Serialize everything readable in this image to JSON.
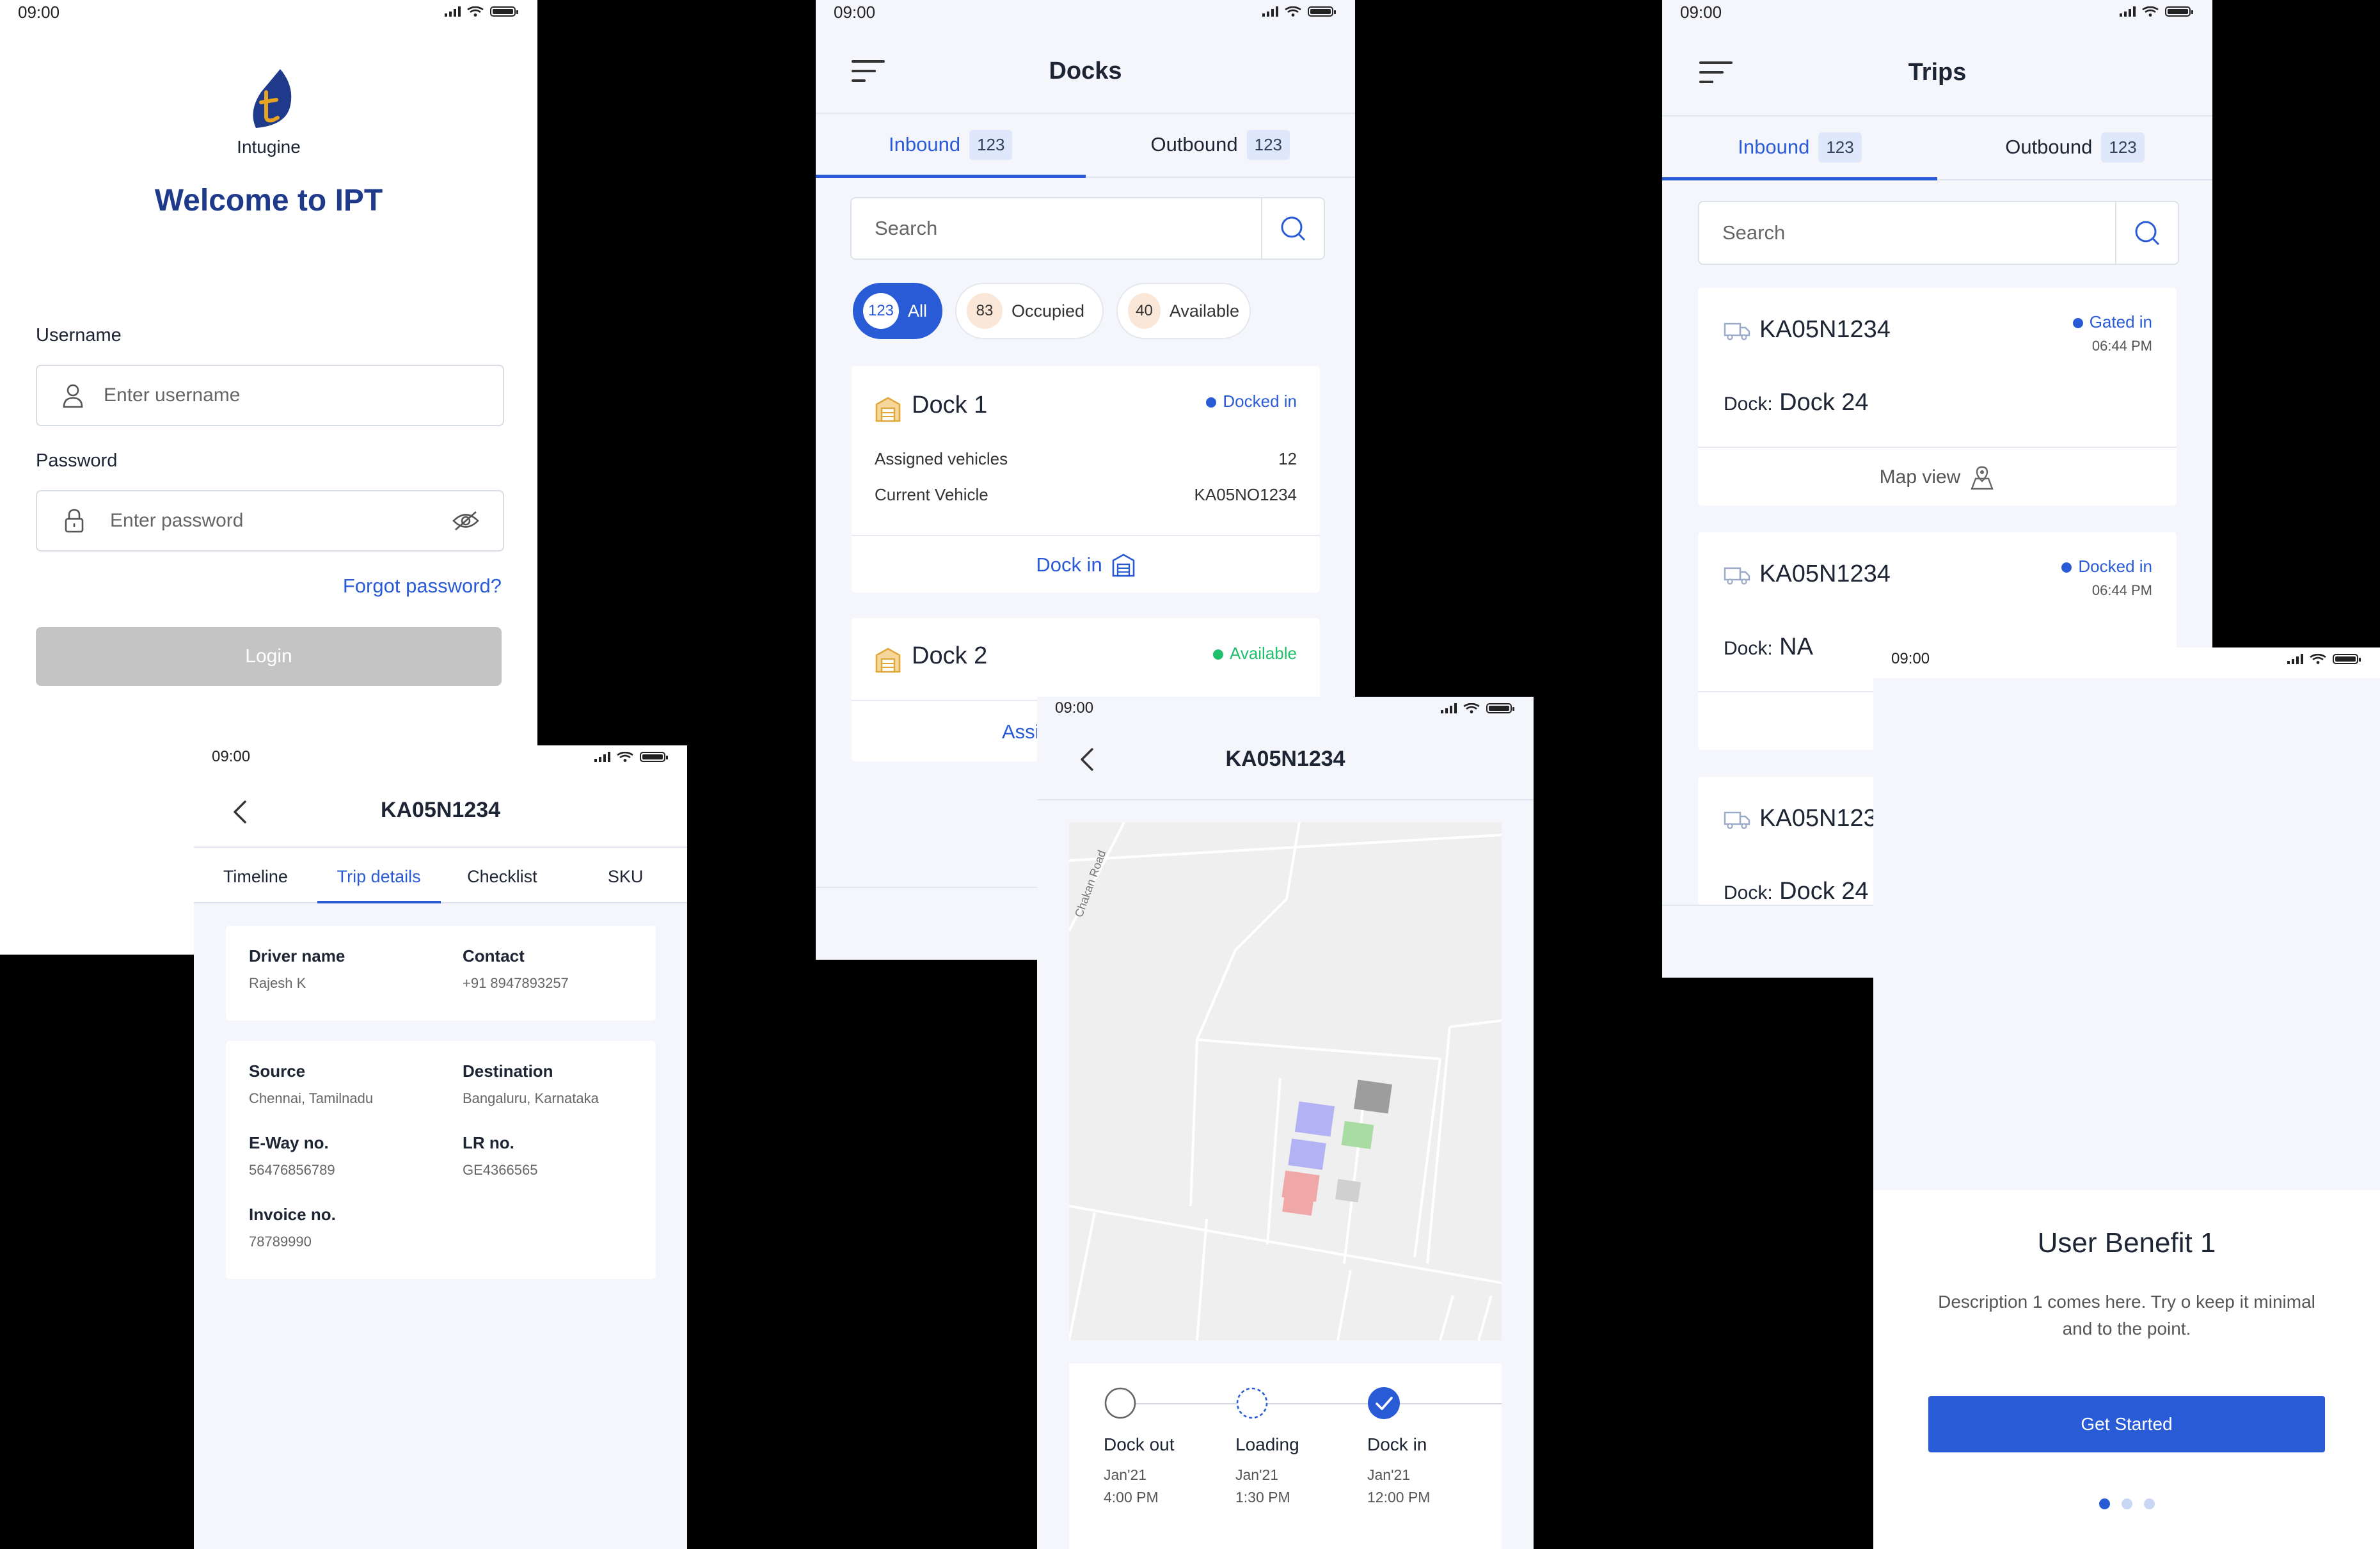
{
  "status": {
    "time": "09:00"
  },
  "login": {
    "logo_text": "Intugine",
    "welcome": "Welcome to IPT",
    "username_label": "Username",
    "username_placeholder": "Enter username",
    "password_label": "Password",
    "password_placeholder": "Enter password",
    "forgot": "Forgot password?",
    "login_button": "Login"
  },
  "docks": {
    "title": "Docks",
    "tabs": [
      {
        "label": "Inbound",
        "count": "123"
      },
      {
        "label": "Outbound",
        "count": "123"
      }
    ],
    "search_placeholder": "Search",
    "filters": [
      {
        "count": "123",
        "label": "All"
      },
      {
        "count": "83",
        "label": "Occupied"
      },
      {
        "count": "40",
        "label": "Available"
      }
    ],
    "cards": [
      {
        "name": "Dock 1",
        "status": "Docked in",
        "rows": [
          {
            "label": "Assigned vehicles",
            "value": "12"
          },
          {
            "label": "Current Vehicle",
            "value": "KA05NO1234"
          }
        ],
        "action": "Dock in"
      },
      {
        "name": "Dock 2",
        "status": "Available",
        "action": "Assi"
      }
    ]
  },
  "trips": {
    "title": "Trips",
    "tabs": [
      {
        "label": "Inbound",
        "count": "123"
      },
      {
        "label": "Outbound",
        "count": "123"
      }
    ],
    "search_placeholder": "Search",
    "dock_label": "Dock:",
    "map_view": "Map view",
    "cards": [
      {
        "vehicle": "KA05N1234",
        "status": "Gated in",
        "time": "06:44 PM",
        "dock": "Dock 24"
      },
      {
        "vehicle": "KA05N1234",
        "status": "Docked in",
        "time": "06:44 PM",
        "dock": "NA"
      },
      {
        "vehicle": "KA05N123",
        "dock": "Dock 24"
      }
    ]
  },
  "trip_details": {
    "title": "KA05N1234",
    "tabs": [
      "Timeline",
      "Trip details",
      "Checklist",
      "SKU"
    ],
    "driver_name_label": "Driver name",
    "driver_name": "Rajesh K",
    "contact_label": "Contact",
    "contact": "+91 8947893257",
    "source_label": "Source",
    "source": "Chennai, Tamilnadu",
    "destination_label": "Destination",
    "destination": "Bangaluru, Karnataka",
    "eway_label": "E-Way no.",
    "eway": "56476856789",
    "lr_label": "LR no.",
    "lr": "GE4366565",
    "invoice_label": "Invoice no.",
    "invoice": "78789990"
  },
  "map_screen": {
    "title": "KA05N1234",
    "road_label": "Chakan Road",
    "steps": [
      {
        "label": "Dock out",
        "date": "Jan'21",
        "time": "4:00 PM",
        "state": "empty"
      },
      {
        "label": "Loading",
        "date": "Jan'21",
        "time": "1:30 PM",
        "state": "progress"
      },
      {
        "label": "Dock in",
        "date": "Jan'21",
        "time": "12:00 PM",
        "state": "done"
      }
    ]
  },
  "onboarding": {
    "title": "User Benefit 1",
    "description_line1": "Description 1 comes here. Try o keep it minimal",
    "description_line2": "and to the point.",
    "button": "Get Started",
    "pages": 3,
    "active_page": 1
  },
  "colors": {
    "accent": "#2a5bd7",
    "brand_navy": "#1f3a8a",
    "available_green": "#1fbf6b",
    "dock_icon": "#e0a83c",
    "login_disabled": "#c4c4c4"
  }
}
